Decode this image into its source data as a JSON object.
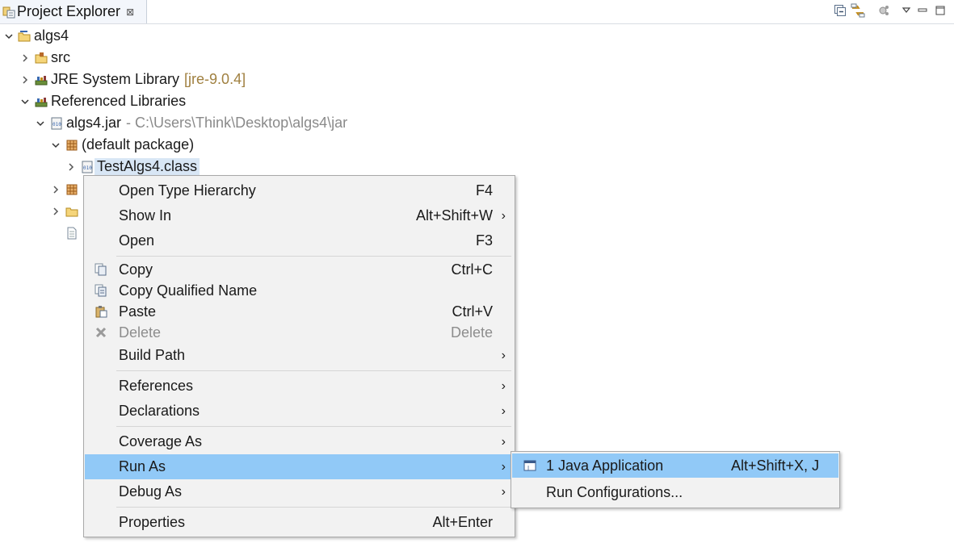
{
  "view": {
    "title": "Project Explorer",
    "close_glyph": "⊠"
  },
  "tree": {
    "root": "algs4",
    "src": "src",
    "jre_label": "JRE System Library",
    "jre_version": "[jre-9.0.4]",
    "ref_libs": "Referenced Libraries",
    "jar_name": "algs4.jar",
    "jar_path": "- C:\\Users\\Think\\Desktop\\algs4\\jar",
    "default_package": "(default package)",
    "selected_class": "TestAlgs4.class"
  },
  "context_menu": {
    "open_type_hierarchy": "Open Type Hierarchy",
    "open_type_hierarchy_key": "F4",
    "show_in": "Show In",
    "show_in_key": "Alt+Shift+W",
    "open": "Open",
    "open_key": "F3",
    "copy": "Copy",
    "copy_key": "Ctrl+C",
    "copy_qualified": "Copy Qualified Name",
    "paste": "Paste",
    "paste_key": "Ctrl+V",
    "delete": "Delete",
    "delete_key": "Delete",
    "build_path": "Build Path",
    "references": "References",
    "declarations": "Declarations",
    "coverage_as": "Coverage As",
    "run_as": "Run As",
    "debug_as": "Debug As",
    "properties": "Properties",
    "properties_key": "Alt+Enter",
    "arrow": "›"
  },
  "submenu": {
    "java_app": "1 Java Application",
    "java_app_key": "Alt+Shift+X, J",
    "run_configs": "Run Configurations..."
  },
  "colors": {
    "highlight": "#91c9f7",
    "menu_bg": "#f2f2f2",
    "selection": "#d8e6f5"
  }
}
